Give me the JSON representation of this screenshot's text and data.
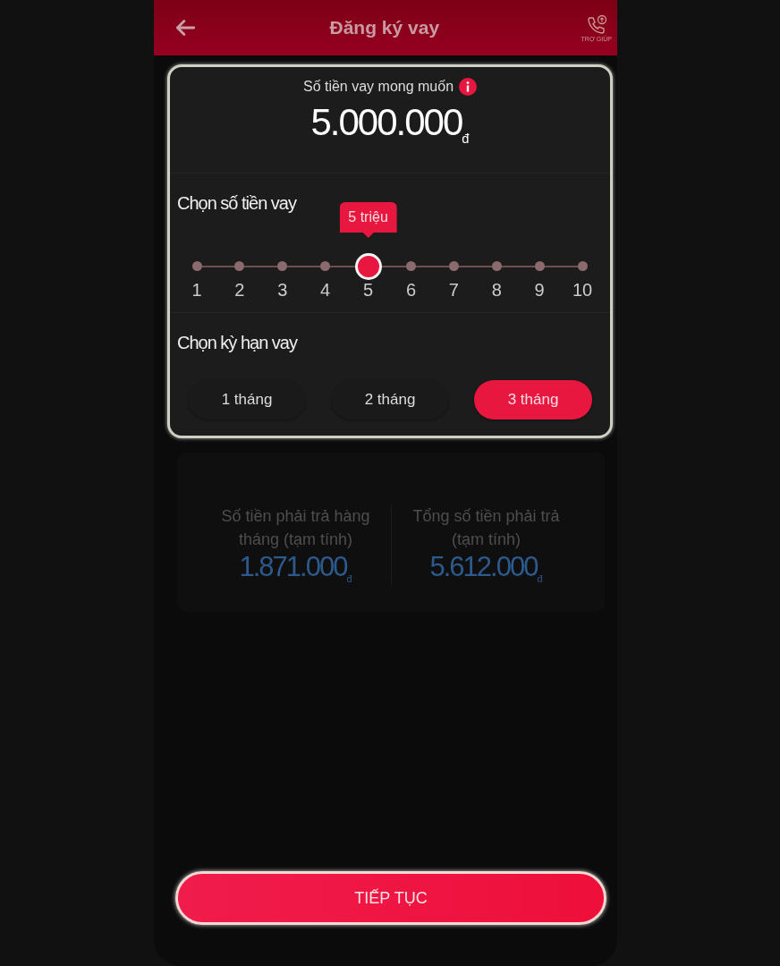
{
  "header": {
    "title": "Đăng ký vay",
    "help_label": "TRỢ GIÚP"
  },
  "amount_card": {
    "label": "Số tiền vay mong muốn",
    "amount": "5.000.000$_{đ}$",
    "amount_section": {
      "title": "Chọn số tiền vay",
      "tooltip": "5 triệu",
      "ticks": [
        {
          "label": "1",
          "selected": false
        },
        {
          "label": "2",
          "selected": false
        },
        {
          "label": "3",
          "selected": false
        },
        {
          "label": "4",
          "selected": false
        },
        {
          "label": "5",
          "selected": true
        },
        {
          "label": "6",
          "selected": false
        },
        {
          "label": "7",
          "selected": false
        },
        {
          "label": "8",
          "selected": false
        },
        {
          "label": "9",
          "selected": false
        },
        {
          "label": "10",
          "selected": false
        }
      ]
    },
    "term_section": {
      "title": "Chọn kỳ hạn vay",
      "options": [
        {
          "label": "1 tháng",
          "selected": false
        },
        {
          "label": "2 tháng",
          "selected": false
        },
        {
          "label": "3 tháng",
          "selected": true
        }
      ]
    }
  },
  "summary": [
    {
      "label": "Số tiền phải trả hàng tháng (tạm tính)",
      "value": "1.871.000$_{đ}$"
    },
    {
      "label": "Tổng số tiền phải trả (tạm tính)",
      "value": "5.612.000$_{đ}$"
    }
  ],
  "continue_button": "TIẾP TỤC"
}
